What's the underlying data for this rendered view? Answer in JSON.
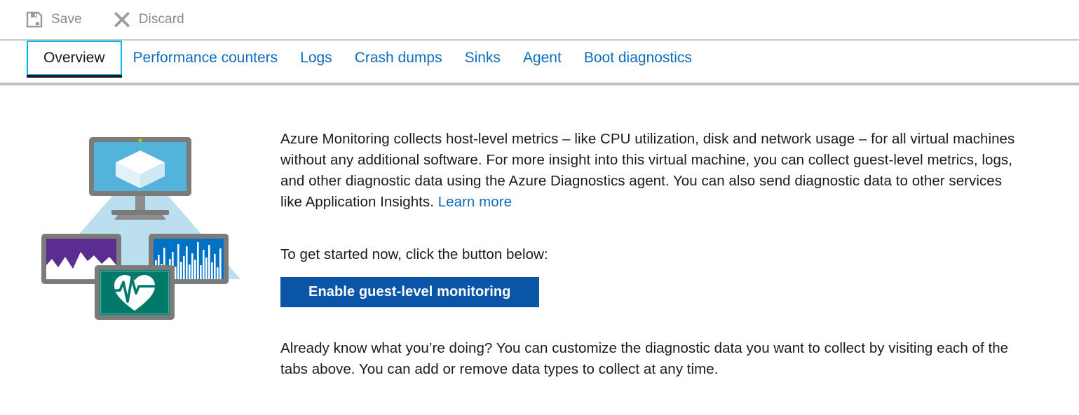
{
  "toolbar": {
    "save": {
      "label": "Save",
      "icon": "save-floppy-icon"
    },
    "discard": {
      "label": "Discard",
      "icon": "close-x-icon"
    }
  },
  "tabs": [
    {
      "label": "Overview",
      "active": true
    },
    {
      "label": "Performance counters",
      "active": false
    },
    {
      "label": "Logs",
      "active": false
    },
    {
      "label": "Crash dumps",
      "active": false
    },
    {
      "label": "Sinks",
      "active": false
    },
    {
      "label": "Agent",
      "active": false
    },
    {
      "label": "Boot diagnostics",
      "active": false
    }
  ],
  "illustration": {
    "name": "azure-monitoring-illustration",
    "parts": [
      "monitor-with-cube-icon",
      "beam-triangle",
      "purple-area-chart-screen",
      "blue-bar-chart-screen",
      "teal-heartbeat-screen"
    ]
  },
  "main": {
    "intro_text": "Azure Monitoring collects host-level metrics – like CPU utilization, disk and network usage – for all virtual machines without any additional software. For more insight into this virtual machine, you can collect guest-level metrics, logs, and other diagnostic data using the Azure Diagnostics agent. You can also send diagnostic data to other services like Application Insights. ",
    "learn_more_label": "Learn more",
    "cta_lead_text": "To get started now, click the button below:",
    "cta_button_label": "Enable guest-level monitoring",
    "closing_text": "Already know what you’re doing? You can customize the diagnostic data you want to collect by visiting each of the tabs above. You can add or remove data types to collect at any time."
  },
  "colors": {
    "link": "#0f6cbd",
    "cta_button_bg": "#0b55a8",
    "active_tab_focus_ring": "#00b4f0",
    "active_tab_underline": "#1b1b1b",
    "toolbar_label": "#8a8a8a",
    "rule": "#c0c0c0"
  }
}
